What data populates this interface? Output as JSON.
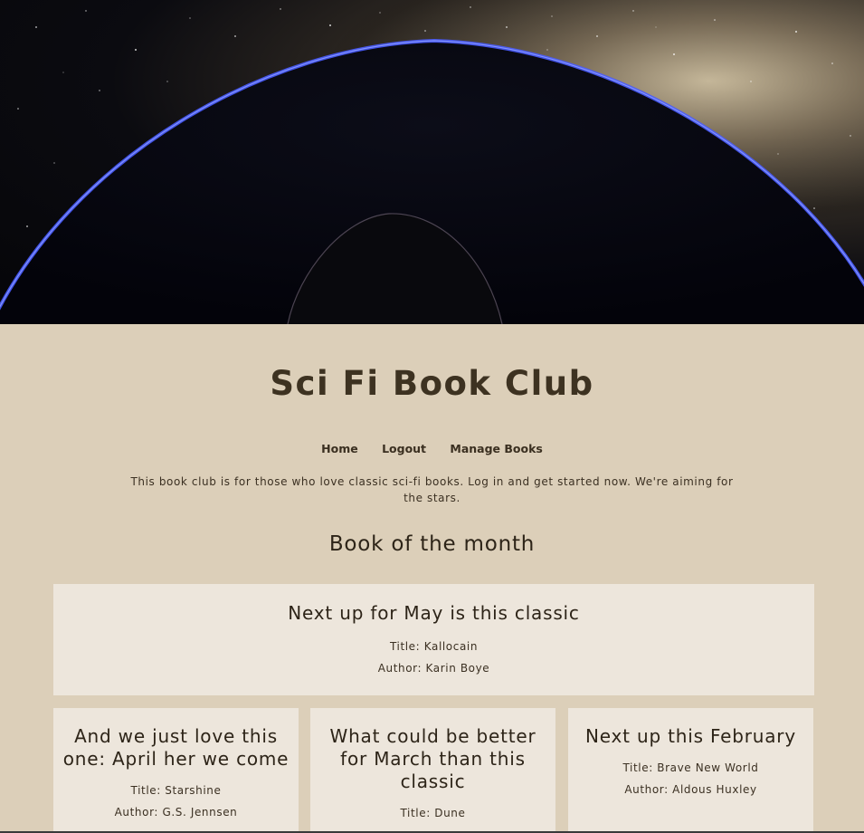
{
  "header": {
    "title": "Sci Fi Book Club"
  },
  "nav": {
    "items": [
      "Home",
      "Logout",
      "Manage Books"
    ]
  },
  "intro": "This book club is for those who love classic sci-fi books. Log in and get started now. We're aiming for the stars.",
  "section_title": "Book of the month",
  "featured": {
    "heading": "Next up for May is this classic",
    "title_line": "Title: Kallocain",
    "author_line": "Author: Karin Boye"
  },
  "cards": [
    {
      "heading": "And we just love this one: April her we come",
      "title_line": "Title: Starshine",
      "author_line": "Author: G.S. Jennsen"
    },
    {
      "heading": "What could be better for March than this classic",
      "title_line": "Title: Dune",
      "author_line": ""
    },
    {
      "heading": "Next up this February",
      "title_line": "Title: Brave New World",
      "author_line": "Author: Aldous Huxley"
    }
  ],
  "colors": {
    "page_background": "#dccfb9",
    "card_background": "#ede6dc",
    "heading_text": "#3d3221",
    "planet_rim": "#4a5cff"
  }
}
